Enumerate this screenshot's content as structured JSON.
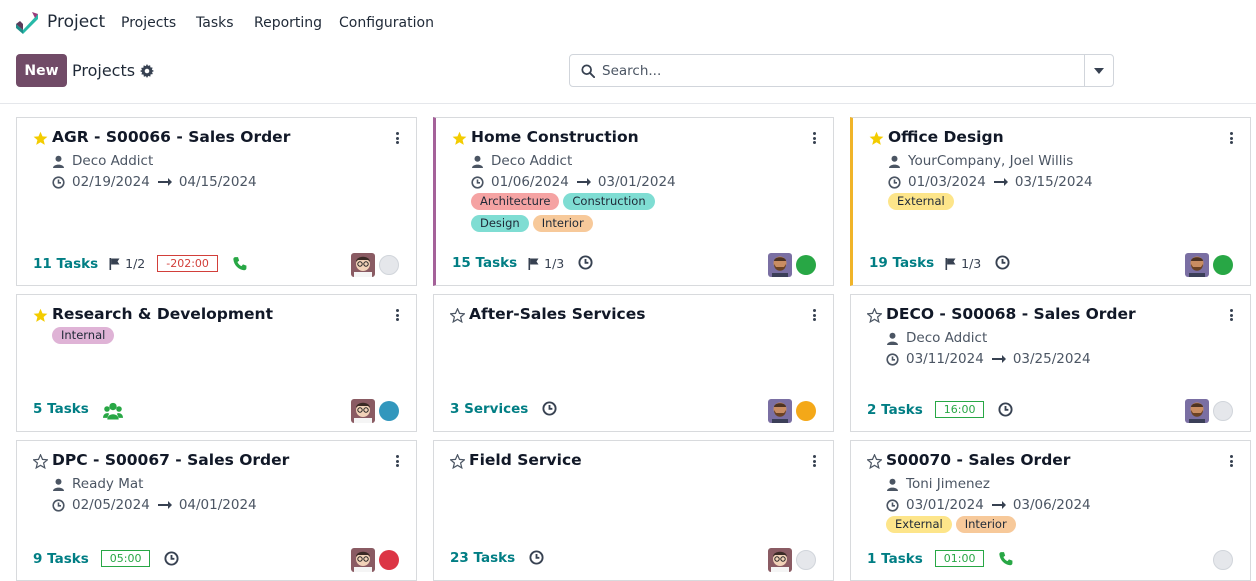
{
  "app": {
    "name": "Project"
  },
  "menu": [
    "Projects",
    "Tasks",
    "Reporting",
    "Configuration"
  ],
  "control_panel": {
    "new_label": "New",
    "breadcrumb": "Projects",
    "search_placeholder": "Search..."
  },
  "colors": {
    "brand": "#714B67",
    "link": "#017e84",
    "accent_purple": "#a46199",
    "accent_yellow": "#f0b429",
    "status_green": "#28a745",
    "status_blue": "#3297bd",
    "status_orange": "#f4a818",
    "status_red": "#dc3545",
    "status_grey": "#e5e7eb"
  },
  "cards": [
    {
      "title": "AGR - S00066 - Sales Order",
      "favorite": true,
      "customer": "Deco Addict",
      "date_start": "02/19/2024",
      "date_end": "04/15/2024",
      "tags": [],
      "count": "11",
      "count_unit": "Tasks",
      "milestone": "1/2",
      "hours": "-202:00",
      "hours_state": "red",
      "icon": "phone-icon",
      "avatar": "avatar-glasses",
      "status": "grey"
    },
    {
      "title": "Home Construction",
      "favorite": true,
      "customer": "Deco Addict",
      "date_start": "01/06/2024",
      "date_end": "03/01/2024",
      "tags": [
        {
          "label": "Architecture",
          "color": "#f5a3a3"
        },
        {
          "label": "Construction",
          "color": "#7fddd3"
        },
        {
          "label": "Design",
          "color": "#7fddd3"
        },
        {
          "label": "Interior",
          "color": "#f7c99a"
        }
      ],
      "count": "15",
      "count_unit": "Tasks",
      "milestone": "1/3",
      "hours": "",
      "hours_state": "",
      "icon": "clock-icon",
      "avatar": "avatar-beard",
      "status": "green"
    },
    {
      "title": "Office Design",
      "favorite": true,
      "customer": "YourCompany, Joel Willis",
      "date_start": "01/03/2024",
      "date_end": "03/15/2024",
      "tags": [
        {
          "label": "External",
          "color": "#fde58a"
        }
      ],
      "count": "19",
      "count_unit": "Tasks",
      "milestone": "1/3",
      "hours": "",
      "hours_state": "",
      "icon": "clock-icon",
      "avatar": "avatar-beard",
      "status": "green"
    },
    {
      "title": "Research & Development",
      "favorite": true,
      "customer": "",
      "date_start": "",
      "date_end": "",
      "tags": [
        {
          "label": "Internal",
          "color": "#dfb3d6"
        }
      ],
      "count": "5",
      "count_unit": "Tasks",
      "milestone": "",
      "hours": "",
      "hours_state": "",
      "icon": "users-icon",
      "avatar": "avatar-glasses",
      "status": "blue"
    },
    {
      "title": "After-Sales Services",
      "favorite": false,
      "customer": "",
      "date_start": "",
      "date_end": "",
      "tags": [],
      "count": "3",
      "count_unit": "Services",
      "milestone": "",
      "hours": "",
      "hours_state": "",
      "icon": "clock-icon",
      "avatar": "avatar-beard",
      "status": "orange"
    },
    {
      "title": "DECO - S00068 - Sales Order",
      "favorite": false,
      "customer": "Deco Addict",
      "date_start": "03/11/2024",
      "date_end": "03/25/2024",
      "tags": [],
      "count": "2",
      "count_unit": "Tasks",
      "milestone": "",
      "hours": "16:00",
      "hours_state": "green",
      "icon": "clock-icon",
      "avatar": "avatar-beard",
      "status": "grey"
    },
    {
      "title": "DPC - S00067 - Sales Order",
      "favorite": false,
      "customer": "Ready Mat",
      "date_start": "02/05/2024",
      "date_end": "04/01/2024",
      "tags": [],
      "count": "9",
      "count_unit": "Tasks",
      "milestone": "",
      "hours": "05:00",
      "hours_state": "green",
      "icon": "clock-icon",
      "avatar": "avatar-glasses",
      "status": "red"
    },
    {
      "title": "Field Service",
      "favorite": false,
      "customer": "",
      "date_start": "",
      "date_end": "",
      "tags": [],
      "count": "23",
      "count_unit": "Tasks",
      "milestone": "",
      "hours": "",
      "hours_state": "",
      "icon": "clock-icon",
      "avatar": "avatar-glasses",
      "status": "grey"
    },
    {
      "title": "S00070 - Sales Order",
      "favorite": false,
      "customer": "Toni Jimenez",
      "date_start": "03/01/2024",
      "date_end": "03/06/2024",
      "tags": [
        {
          "label": "External",
          "color": "#fde58a"
        },
        {
          "label": "Interior",
          "color": "#f7c99a"
        }
      ],
      "count": "1",
      "count_unit": "Tasks",
      "milestone": "",
      "hours": "01:00",
      "hours_state": "green",
      "icon": "phone-icon",
      "avatar": "",
      "status": "grey"
    }
  ]
}
